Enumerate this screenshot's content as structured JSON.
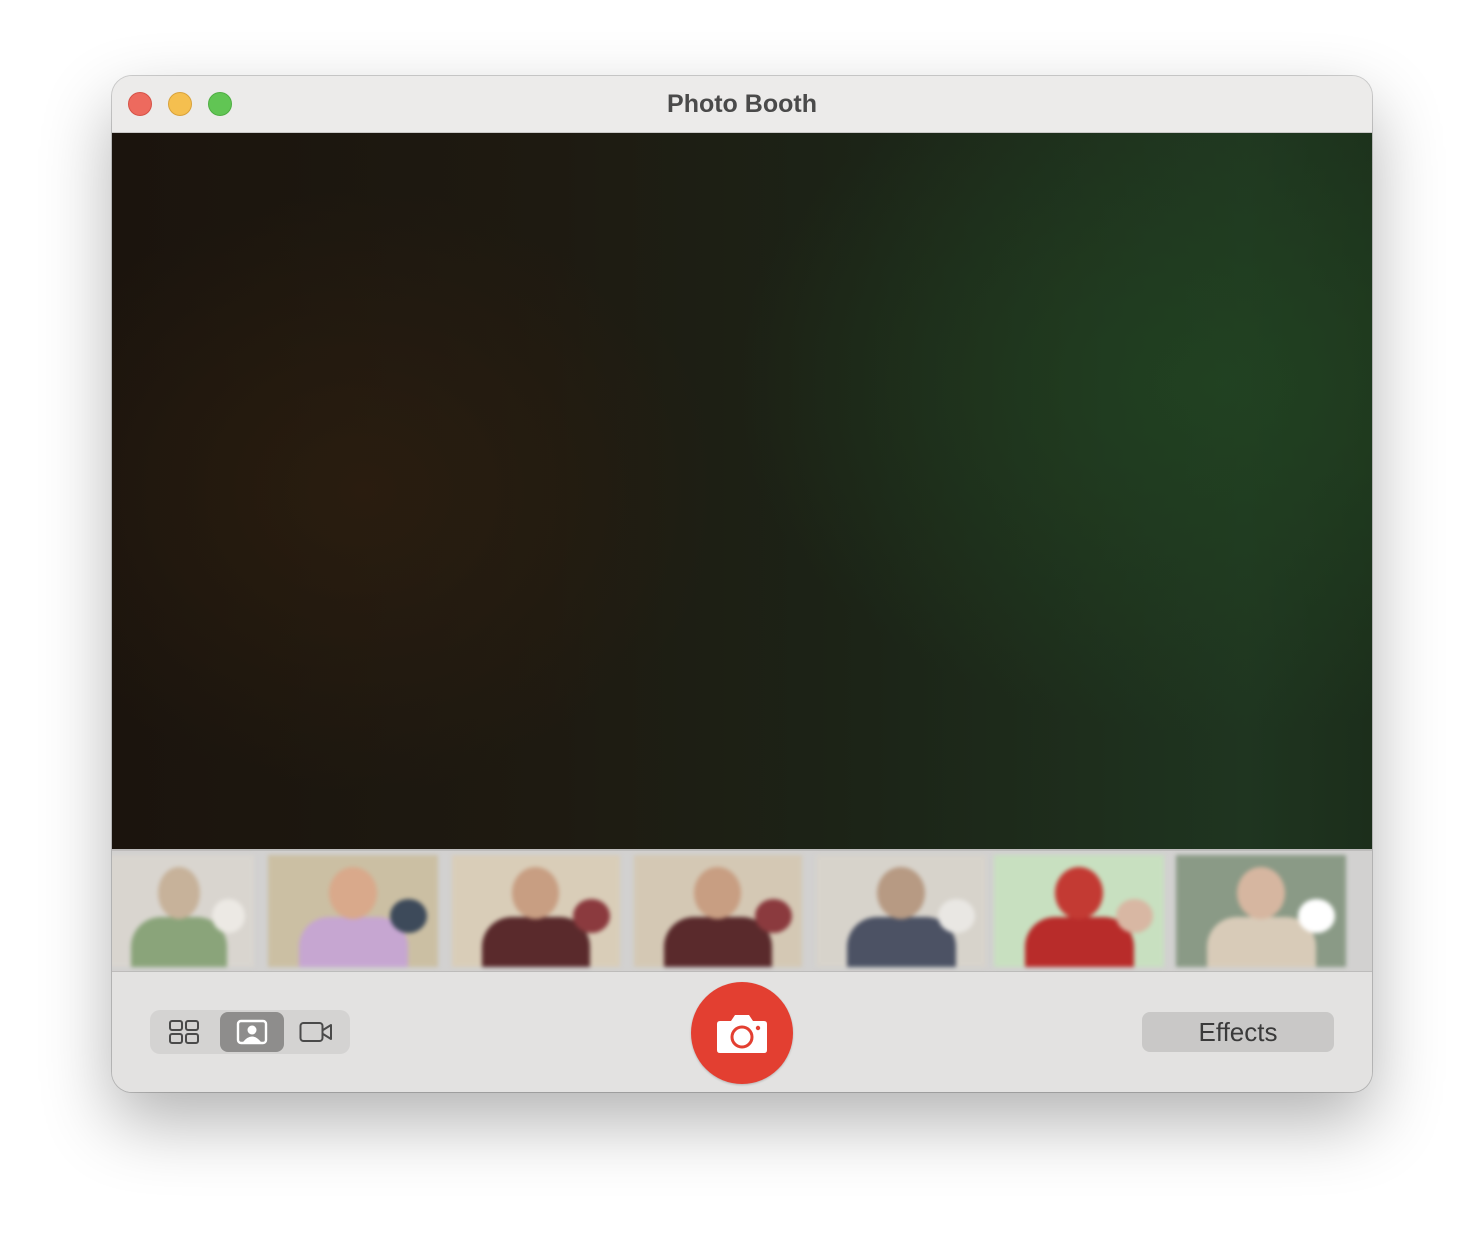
{
  "window": {
    "title": "Photo Booth"
  },
  "filmstrip": {
    "thumbnails": [
      {
        "bg": "#d9d5cf",
        "head": "#c7b29a",
        "body": "#8aa47a",
        "extra": "#ece9e4"
      },
      {
        "bg": "#cbbfa3",
        "head": "#d9a98b",
        "body": "#c6a6d1",
        "extra": "#3d4a5a"
      },
      {
        "bg": "#d9cdb8",
        "head": "#c89e82",
        "body": "#5a2a2c",
        "extra": "#8b3a3e"
      },
      {
        "bg": "#d4c8b4",
        "head": "#c89e82",
        "body": "#5a2a2c",
        "extra": "#8b3a3e"
      },
      {
        "bg": "#d7d3cb",
        "head": "#b79a83",
        "body": "#4c5264",
        "extra": "#e9e7e3"
      },
      {
        "bg": "#c8e0c0",
        "head": "#c33a33",
        "body": "#b82c2a",
        "extra": "#d8b7a3"
      },
      {
        "bg": "#8a9a86",
        "head": "#d6b6a0",
        "body": "#d8cbb8",
        "extra": "#ffffff"
      }
    ]
  },
  "toolbar": {
    "modes": [
      {
        "name": "grid-view",
        "icon": "four-grid-icon"
      },
      {
        "name": "single-photo",
        "icon": "portrait-icon",
        "selected": true
      },
      {
        "name": "video",
        "icon": "video-camera-icon"
      }
    ],
    "shutter_icon": "camera-icon",
    "effects_label": "Effects"
  }
}
